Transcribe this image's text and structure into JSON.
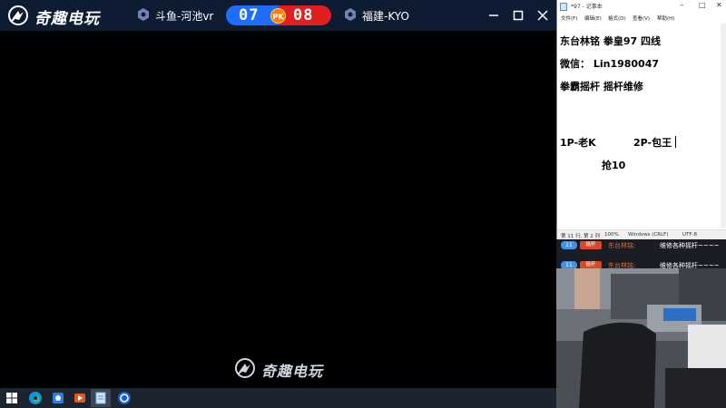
{
  "game_window": {
    "app_name": "奇趣电玩",
    "player1": "斗鱼-河池vr",
    "player2": "福建-KYO",
    "score_left": "07",
    "score_right": "08",
    "pk_label": "PK",
    "watermark": "奇趣电玩",
    "colors": {
      "titlebar": "#0d1b33",
      "score_left_bg": "#1e6dff",
      "score_right_bg": "#e02020",
      "pk_badge": "#ff7a14"
    }
  },
  "notepad": {
    "title": "*97 - 记事本",
    "menu": [
      "文件(F)",
      "编辑(E)",
      "格式(O)",
      "查看(V)",
      "帮助(H)"
    ],
    "lines": [
      "东台林铭 拳皇97 四线",
      "微信：  Lin1980047",
      "拳霸摇杆  摇杆维修",
      "1P-老K",
      "2P-包王",
      "抢10"
    ],
    "status": [
      "第 11 行, 第 2 列",
      "100%",
      "Windows (CRLF)",
      "UTF-8"
    ]
  },
  "chat": {
    "messages": [
      {
        "level": "11",
        "fan": "摇杆",
        "user": "东台林铭:",
        "text": "维修各种摇杆~~~~"
      },
      {
        "level": "11",
        "fan": "摇杆",
        "user": "东台林铭:",
        "text": "维修各种摇杆~~~~"
      }
    ]
  },
  "taskbar": {
    "icons": [
      "windows-start-icon",
      "edge-icon",
      "app-icon",
      "app-icon",
      "notepad-icon",
      "game-icon"
    ]
  }
}
